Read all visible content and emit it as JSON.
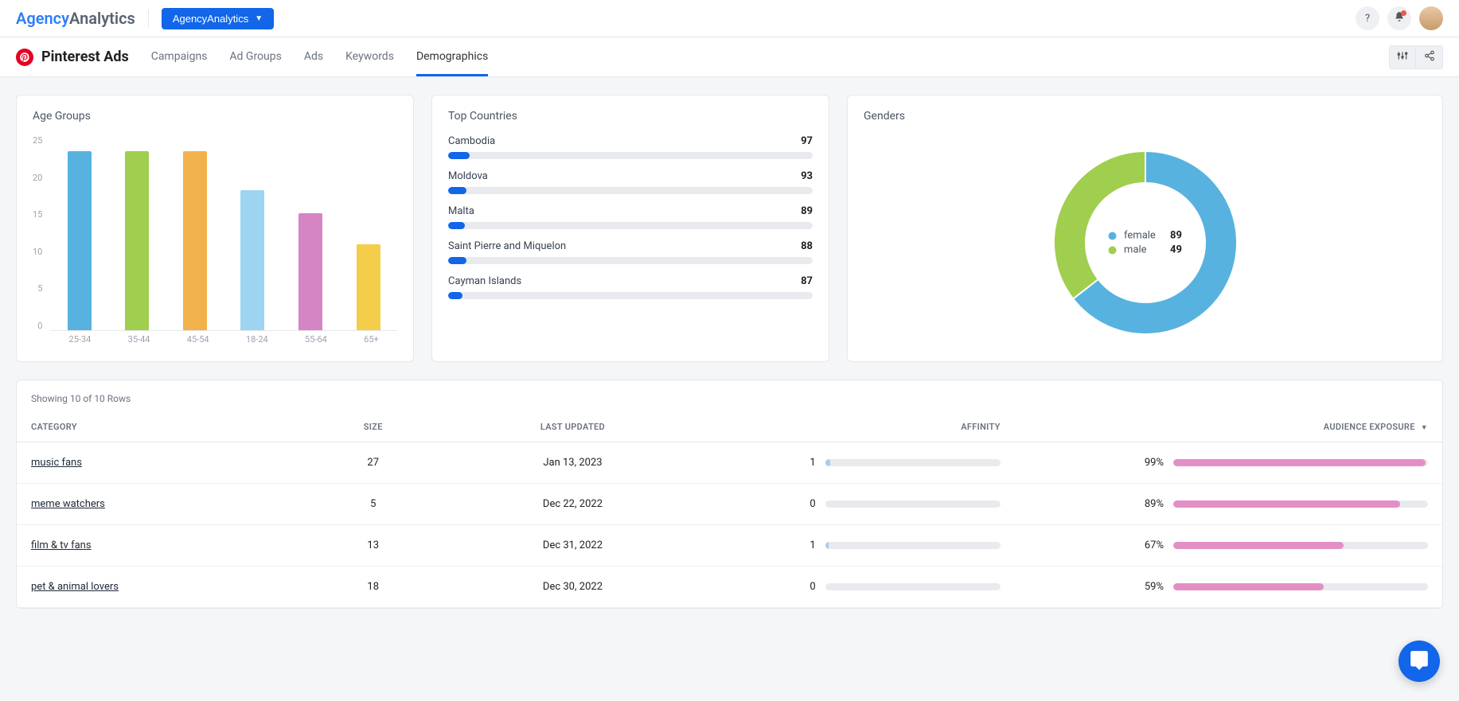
{
  "header": {
    "logo_agency": "Agency",
    "logo_analytics": "Analytics",
    "workspace_label": "AgencyAnalytics"
  },
  "subheader": {
    "page_title": "Pinterest Ads",
    "tabs": [
      {
        "label": "Campaigns",
        "active": false
      },
      {
        "label": "Ad Groups",
        "active": false
      },
      {
        "label": "Ads",
        "active": false
      },
      {
        "label": "Keywords",
        "active": false
      },
      {
        "label": "Demographics",
        "active": true
      }
    ]
  },
  "cards": {
    "age_groups_title": "Age Groups",
    "top_countries_title": "Top Countries",
    "genders_title": "Genders"
  },
  "chart_data": [
    {
      "type": "bar",
      "title": "Age Groups",
      "categories": [
        "25-34",
        "35-44",
        "45-54",
        "18-24",
        "55-64",
        "65+"
      ],
      "values": [
        23,
        23,
        23,
        18,
        15,
        11
      ],
      "colors": [
        "#57b2e0",
        "#a0ce4e",
        "#f2b24b",
        "#9dd4f2",
        "#d584c4",
        "#f4ce4a"
      ],
      "ylim": [
        0,
        25
      ],
      "yticks": [
        0,
        5,
        10,
        15,
        20,
        25
      ],
      "xlabel": "",
      "ylabel": ""
    },
    {
      "type": "bar",
      "title": "Top Countries",
      "categories": [
        "Cambodia",
        "Moldova",
        "Malta",
        "Saint Pierre and Miquelon",
        "Cayman Islands"
      ],
      "values": [
        97,
        93,
        89,
        88,
        87
      ],
      "fill_percent": [
        6,
        5,
        4.5,
        5,
        4
      ],
      "color": "#1166e9"
    },
    {
      "type": "pie",
      "title": "Genders",
      "series": [
        {
          "name": "female",
          "value": 89,
          "color": "#57b2e0"
        },
        {
          "name": "male",
          "value": 49,
          "color": "#a0ce4e"
        }
      ]
    }
  ],
  "table": {
    "meta": "Showing 10 of 10 Rows",
    "columns": {
      "category": "CATEGORY",
      "size": "SIZE",
      "last_updated": "LAST UPDATED",
      "affinity": "AFFINITY",
      "audience_exposure": "AUDIENCE EXPOSURE"
    },
    "rows": [
      {
        "category": "music fans",
        "size": "27",
        "last_updated": "Jan 13, 2023",
        "affinity": "1",
        "affinity_pct": 3,
        "exposure_label": "99%",
        "exposure_pct": 99
      },
      {
        "category": "meme watchers",
        "size": "5",
        "last_updated": "Dec 22, 2022",
        "affinity": "0",
        "affinity_pct": 0,
        "exposure_label": "89%",
        "exposure_pct": 89
      },
      {
        "category": "film & tv fans",
        "size": "13",
        "last_updated": "Dec 31, 2022",
        "affinity": "1",
        "affinity_pct": 2,
        "exposure_label": "67%",
        "exposure_pct": 67
      },
      {
        "category": "pet & animal lovers",
        "size": "18",
        "last_updated": "Dec 30, 2022",
        "affinity": "0",
        "affinity_pct": 0,
        "exposure_label": "59%",
        "exposure_pct": 59
      }
    ]
  }
}
